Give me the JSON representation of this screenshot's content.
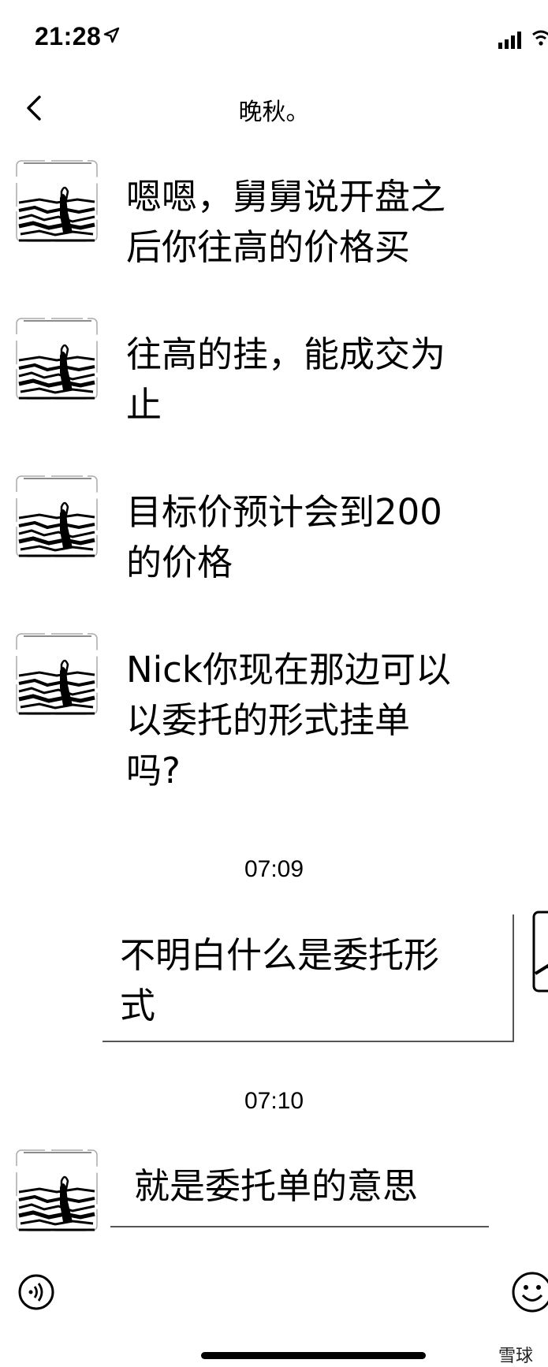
{
  "status_bar": {
    "time": "21:28",
    "icons": [
      "location-arrow-icon",
      "signal-icon",
      "wifi-icon"
    ]
  },
  "nav": {
    "title": "晚秋。",
    "back_icon": "chevron-left-icon"
  },
  "messages": [
    {
      "sender": "other",
      "text": "嗯嗯，舅舅说开盘之\n后你往高的价格买"
    },
    {
      "sender": "other",
      "text": "往高的挂，能成交为\n止"
    },
    {
      "sender": "other",
      "text": "目标价预计会到200\n的价格"
    },
    {
      "sender": "other",
      "text": "Nick你现在那边可以\n以委托的形式挂单\n吗?"
    },
    {
      "sender": "self",
      "text": "不明白什么是委托形\n式"
    },
    {
      "sender": "other",
      "text": "就是委托单的意思"
    }
  ],
  "timestamps": [
    "07:09",
    "07:10"
  ],
  "bottom_bar": {
    "voice_icon": "voice-icon",
    "emoji_icon": "emoji-icon"
  },
  "watermark": {
    "text": "雪球"
  }
}
